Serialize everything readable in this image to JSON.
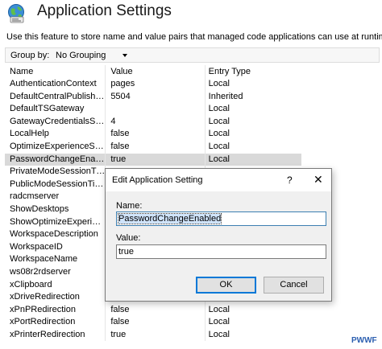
{
  "header": {
    "icon": "globe-settings-icon",
    "title": "Application Settings",
    "description": "Use this feature to store name and value pairs that managed code applications can use at runtime."
  },
  "toolbar": {
    "group_by_label": "Group by:",
    "group_by_value": "No Grouping"
  },
  "grid": {
    "columns": {
      "name": "Name",
      "value": "Value",
      "entry_type": "Entry Type"
    },
    "rows": [
      {
        "name": "AuthenticationContext",
        "value": "pages",
        "entry": "Local"
      },
      {
        "name": "DefaultCentralPublishin...",
        "value": "5504",
        "entry": "Inherited"
      },
      {
        "name": "DefaultTSGateway",
        "value": "",
        "entry": "Local"
      },
      {
        "name": "GatewayCredentialsSource",
        "value": "4",
        "entry": "Local"
      },
      {
        "name": "LocalHelp",
        "value": "false",
        "entry": "Local"
      },
      {
        "name": "OptimizeExperienceState",
        "value": "false",
        "entry": "Local"
      },
      {
        "name": "PasswordChangeEnabled",
        "value": "true",
        "entry": "Local",
        "selected": true
      },
      {
        "name": "PrivateModeSessionTim...",
        "value": "",
        "entry": ""
      },
      {
        "name": "PublicModeSessionTime...",
        "value": "",
        "entry": ""
      },
      {
        "name": "radcmserver",
        "value": "",
        "entry": ""
      },
      {
        "name": "ShowDesktops",
        "value": "",
        "entry": ""
      },
      {
        "name": "ShowOptimizeExperience",
        "value": "",
        "entry": ""
      },
      {
        "name": "WorkspaceDescription",
        "value": "",
        "entry": ""
      },
      {
        "name": "WorkspaceID",
        "value": "",
        "entry": ""
      },
      {
        "name": "WorkspaceName",
        "value": "",
        "entry": ""
      },
      {
        "name": "ws08r2rdserver",
        "value": "",
        "entry": ""
      },
      {
        "name": "xClipboard",
        "value": "",
        "entry": ""
      },
      {
        "name": "xDriveRedirection",
        "value": "",
        "entry": ""
      },
      {
        "name": "xPnPRedirection",
        "value": "false",
        "entry": "Local"
      },
      {
        "name": "xPortRedirection",
        "value": "false",
        "entry": "Local"
      },
      {
        "name": "xPrinterRedirection",
        "value": "true",
        "entry": "Local"
      }
    ]
  },
  "dialog": {
    "title": "Edit Application Setting",
    "help": "?",
    "close": "✕",
    "name_label": "Name:",
    "name_value": "PasswordChangeEnabled",
    "value_label": "Value:",
    "value_value": "true",
    "ok_label": "OK",
    "cancel_label": "Cancel"
  },
  "watermark": "PWWF"
}
